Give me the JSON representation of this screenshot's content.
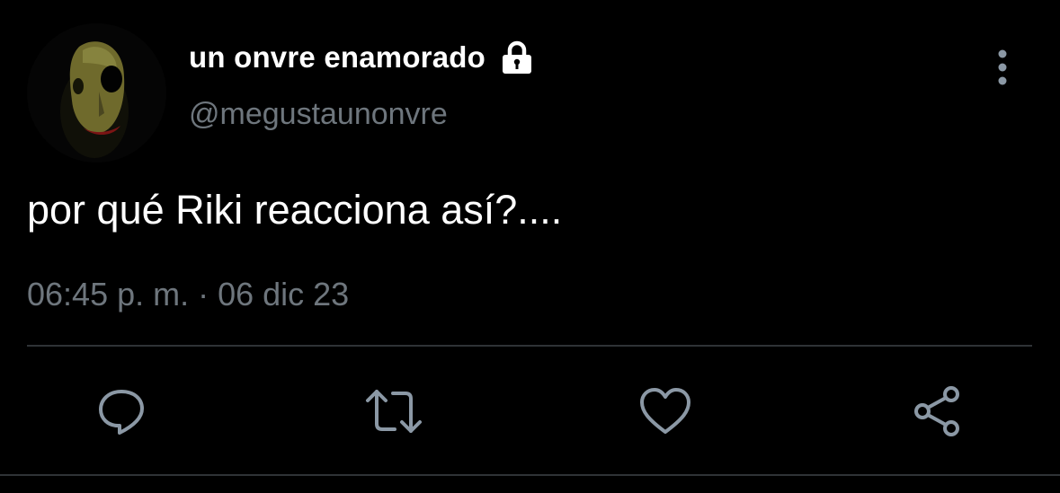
{
  "tweet": {
    "display_name": "un onvre enamorado",
    "handle": "@megustaunonvre",
    "text": "por qué Riki reacciona así?....",
    "timestamp": "06:45 p. m. · 06 dic 23"
  },
  "icons": {
    "avatar": "avatar-image",
    "lock": "lock-icon",
    "more": "more-vertical-icon",
    "reply": "reply-icon",
    "retweet": "retweet-icon",
    "like": "heart-icon",
    "share": "share-icon"
  },
  "colors": {
    "background": "#000000",
    "primary_text": "#ffffff",
    "secondary_text": "#6e767d",
    "divider": "#2f3336",
    "icon": "#8b98a5"
  }
}
